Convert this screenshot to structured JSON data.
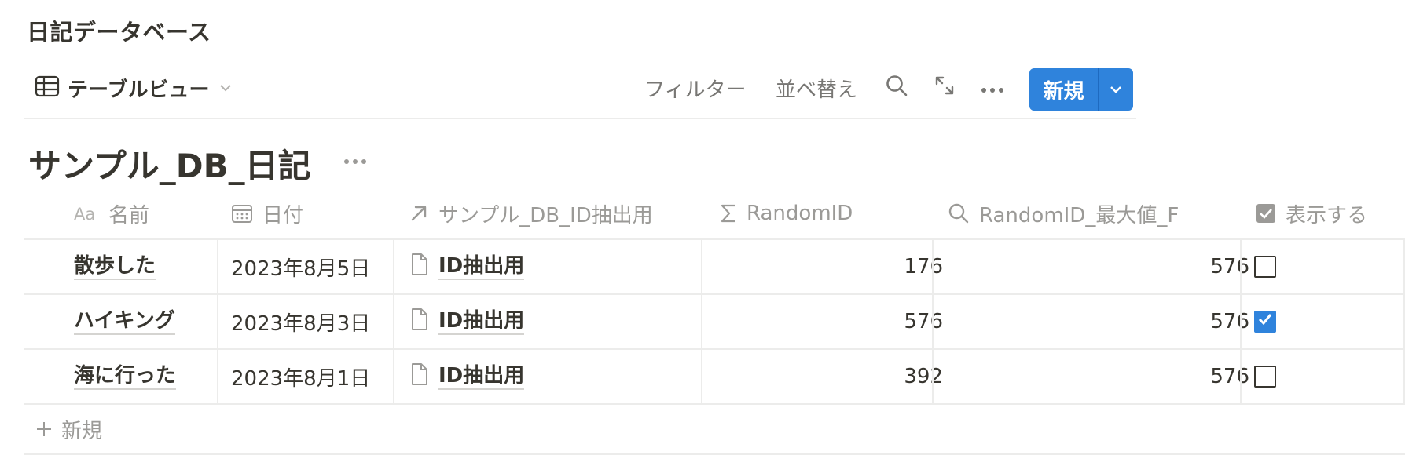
{
  "page": {
    "title": "日記データベース"
  },
  "toolbar": {
    "view_label": "テーブルビュー",
    "filter_label": "フィルター",
    "sort_label": "並べ替え",
    "new_label": "新規"
  },
  "database": {
    "title": "サンプル_DB_日記"
  },
  "columns": [
    {
      "label": "名前",
      "icon": "text-property-icon"
    },
    {
      "label": "日付",
      "icon": "calendar-icon"
    },
    {
      "label": "サンプル_DB_ID抽出用",
      "icon": "relation-arrow-icon"
    },
    {
      "label": "RandomID",
      "icon": "sigma-icon"
    },
    {
      "label": "RandomID_最大値_F",
      "icon": "search-icon"
    },
    {
      "label": "表示する",
      "icon": "checkbox-property-icon"
    }
  ],
  "rows": [
    {
      "name": "散歩した",
      "date": "2023年8月5日",
      "relation": "ID抽出用",
      "random_id": "176",
      "max_id": "576",
      "show": false
    },
    {
      "name": "ハイキング",
      "date": "2023年8月3日",
      "relation": "ID抽出用",
      "random_id": "576",
      "max_id": "576",
      "show": true
    },
    {
      "name": "海に行った",
      "date": "2023年8月1日",
      "relation": "ID抽出用",
      "random_id": "392",
      "max_id": "576",
      "show": false
    }
  ],
  "footer": {
    "new_row_label": "新規"
  },
  "colors": {
    "accent": "#2f83dc",
    "text": "#37352f",
    "muted": "#9b9a97",
    "border": "#ececeb"
  }
}
